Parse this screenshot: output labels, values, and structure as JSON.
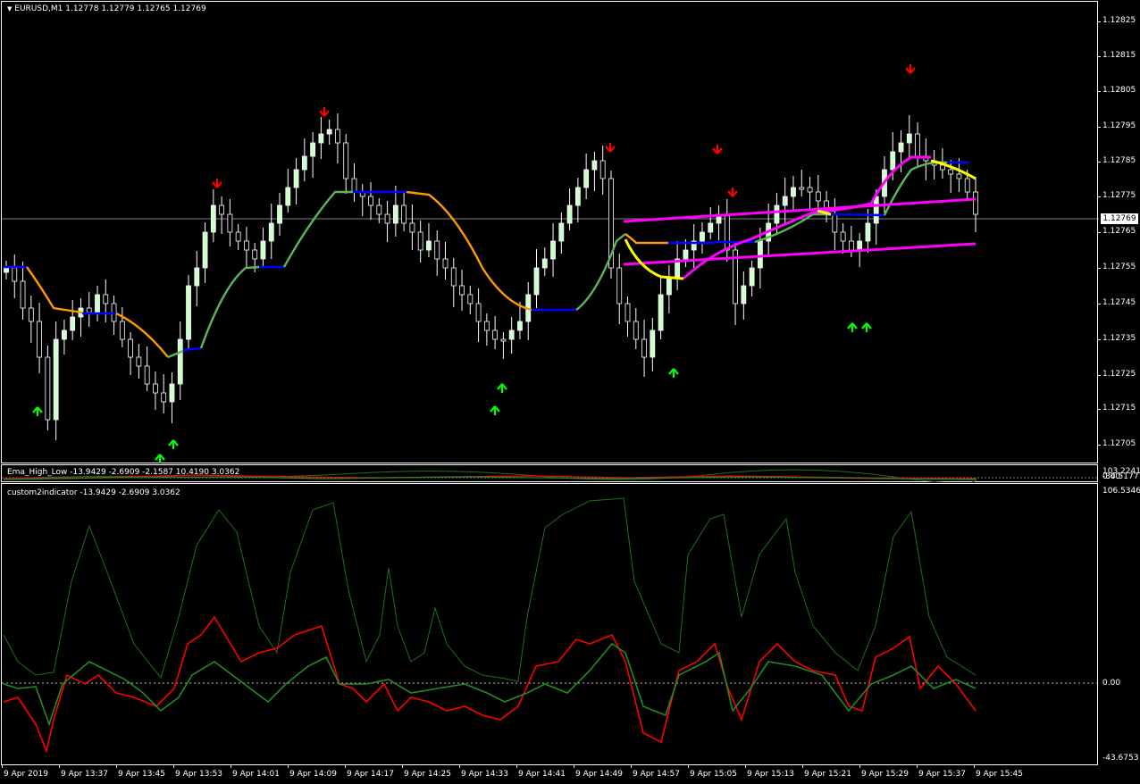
{
  "main": {
    "header": "EURUSD,M1  1.12778 1.12779 1.12765 1.12769",
    "current_price": "1.12769",
    "price_ticks": [
      "1.12825",
      "1.12815",
      "1.12805",
      "1.12795",
      "1.12785",
      "1.12775",
      "1.12765",
      "1.12755",
      "1.12745",
      "1.12735",
      "1.12725",
      "1.12715",
      "1.12705"
    ]
  },
  "sub1": {
    "header": "Ema_High_Low -13.9429 -2.6909 -2.1587 10.4190 3.0362",
    "ticks": [
      "103.2241",
      "0.00",
      "-34.5177"
    ]
  },
  "sub2": {
    "header": "custom2indicator -13.9429 -2.6909 3.0362",
    "ticks": [
      "106.5346",
      "0.00",
      "-43.6753"
    ]
  },
  "time_axis": [
    "9 Apr 2019",
    "9 Apr 13:37",
    "9 Apr 13:45",
    "9 Apr 13:53",
    "9 Apr 14:01",
    "9 Apr 14:09",
    "9 Apr 14:17",
    "9 Apr 14:25",
    "9 Apr 14:33",
    "9 Apr 14:41",
    "9 Apr 14:49",
    "9 Apr 14:57",
    "9 Apr 15:05",
    "9 Apr 15:13",
    "9 Apr 15:21",
    "9 Apr 15:29",
    "9 Apr 15:37",
    "9 Apr 15:45"
  ],
  "colors": {
    "bull_candle": "#ccffcc",
    "bear_candle": "#000000",
    "ma_up": "#5cb85c",
    "ma_down": "#ff9900",
    "ma_flat": "#0000ff",
    "channel": "#ff00ff",
    "fast_ma": "#ffff00",
    "arrow_up": "#00ff00",
    "arrow_down": "#ff0000",
    "osc_red": "#ff0000",
    "osc_green": "#228b22",
    "osc_envelope": "#1f6e1f"
  }
}
